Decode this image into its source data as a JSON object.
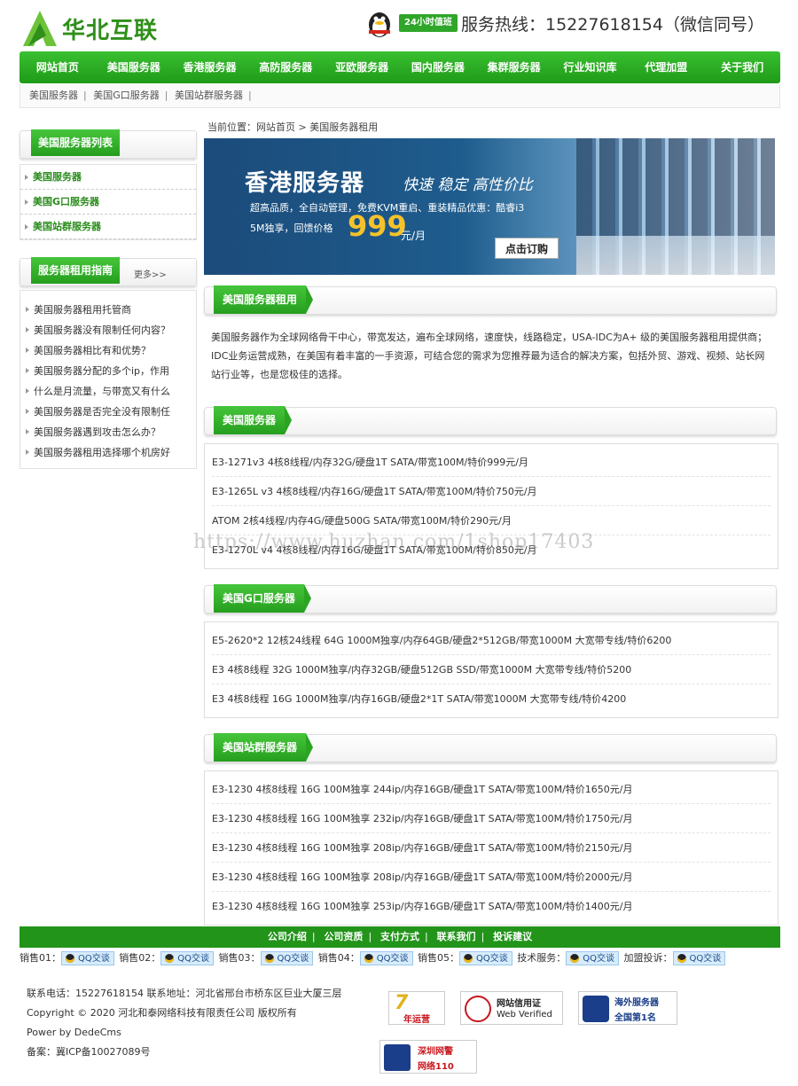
{
  "header": {
    "logo_text": "华北互联",
    "badge": "24小时值班",
    "hotline": "服务热线：15227618154（微信同号）"
  },
  "nav": [
    "网站首页",
    "美国服务器",
    "香港服务器",
    "高防服务器",
    "亚欧服务器",
    "国内服务器",
    "集群服务器",
    "行业知识库",
    "代理加盟",
    "关于我们"
  ],
  "subnav": [
    "美国服务器",
    "美国G口服务器",
    "美国站群服务器"
  ],
  "sidebar": {
    "list_title": "美国服务器列表",
    "list_items": [
      "美国服务器",
      "美国G口服务器",
      "美国站群服务器"
    ],
    "guide_title": "服务器租用指南",
    "guide_more": "更多>>",
    "guide_items": [
      "美国服务器租用托管商",
      "美国服务器没有限制任何内容？",
      "美国服务器相比有和优势？",
      "美国服务器分配的多个ip，作用",
      "什么是月流量，与带宽又有什么",
      "美国服务器是否完全没有限制任",
      "美国服务器遇到攻击怎么办？",
      "美国服务器租用选择哪个机房好"
    ]
  },
  "main": {
    "breadcrumb": "当前位置：网站首页 > 美国服务器租用",
    "banner": {
      "title": "香港服务器",
      "slogan": "快速 稳定 高性价比",
      "desc": "超高品质，全自动管理，免费KVM重启、重装精品优惠：酷睿i3",
      "price_label": "5M独享，回馈价格",
      "price": "999",
      "unit": "元/月",
      "button": "点击订购"
    },
    "intro_title": "美国服务器租用",
    "intro_text": "美国服务器作为全球网络骨干中心，带宽发达，遍布全球网络，速度快，线路稳定，USA-IDC为A+ 级的美国服务器租用提供商；IDC业务运营成熟，在美国有着丰富的一手资源，可结合您的需求为您推荐最为适合的解决方案，包括外贸、游戏、视频、站长网站行业等，也是您极佳的选择。",
    "sections": [
      {
        "title": "美国服务器",
        "rows": [
          "E3-1271v3 4核8线程/内存32G/硬盘1T SATA/带宽100M/特价999元/月",
          "E3-1265L v3 4核8线程/内存16G/硬盘1T SATA/带宽100M/特价750元/月",
          "ATOM 2核4线程/内存4G/硬盘500G SATA/带宽100M/特价290元/月",
          "E3-1270L v4 4核8线程/内存16G/硬盘1T SATA/带宽100M/特价850元/月"
        ]
      },
      {
        "title": "美国G口服务器",
        "rows": [
          "E5-2620*2 12核24线程 64G 1000M独享/内存64GB/硬盘2*512GB/带宽1000M 大宽带专线/特价6200",
          "E3 4核8线程 32G 1000M独享/内存32GB/硬盘512GB SSD/带宽1000M 大宽带专线/特价5200",
          "E3 4核8线程 16G 1000M独享/内存16GB/硬盘2*1T SATA/带宽1000M 大宽带专线/特价4200"
        ]
      },
      {
        "title": "美国站群服务器",
        "rows": [
          "E3-1230 4核8线程 16G 100M独享 244ip/内存16GB/硬盘1T SATA/带宽100M/特价1650元/月",
          "E3-1230 4核8线程 16G 100M独享 232ip/内存16GB/硬盘1T SATA/带宽100M/特价1750元/月",
          "E3-1230 4核8线程 16G 100M独享 208ip/内存16GB/硬盘1T SATA/带宽100M/特价2150元/月",
          "E3-1230 4核8线程 16G 100M独享 208ip/内存16GB/硬盘1T SATA/带宽100M/特价2000元/月",
          "E3-1230 4核8线程 16G 100M独享 253ip/内存16GB/硬盘1T SATA/带宽100M/特价1400元/月"
        ]
      }
    ]
  },
  "watermark": "https://www.huzhan.com/1shop17403",
  "footer": {
    "links": [
      "公司介绍",
      "公司资质",
      "支付方式",
      "联系我们",
      "投诉建议"
    ],
    "qq_label": "QQ交谈",
    "contacts": [
      "销售01：",
      "销售02：",
      "销售03：",
      "销售04：",
      "销售05：",
      "技术服务：",
      "加盟投诉："
    ],
    "info": [
      "联系电话：15227618154 联系地址：河北省邢台市桥东区巨业大厦三层",
      "Copyright © 2020 河北和泰网络科技有限责任公司 版权所有",
      "Power by DedeCms",
      "备案：冀ICP备10027089号"
    ],
    "seals": {
      "s1": "年运营",
      "s2_line1": "网站信用证",
      "s2_line2": "Web Verified",
      "s3_line1": "海外服务器",
      "s3_line2": "全国第1名",
      "s4_line1": "深圳网警",
      "s4_line2": "网络110"
    }
  },
  "colors": {
    "brand_green": "#22941a",
    "accent_gold": "#f6c22a"
  }
}
